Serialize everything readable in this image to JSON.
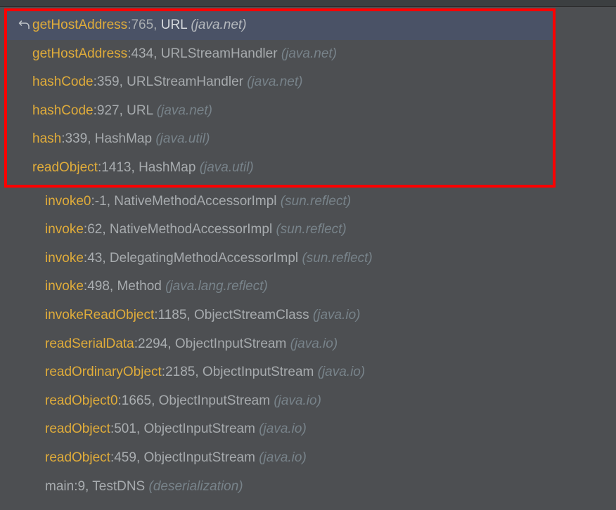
{
  "frames": [
    {
      "method": "getHostAddress",
      "line": "765",
      "class": "URL",
      "package": "(java.net)",
      "selected": true,
      "hasIcon": true,
      "inBox": true
    },
    {
      "method": "getHostAddress",
      "line": "434",
      "class": "URLStreamHandler",
      "package": "(java.net)",
      "selected": false,
      "hasIcon": false,
      "inBox": true
    },
    {
      "method": "hashCode",
      "line": "359",
      "class": "URLStreamHandler",
      "package": "(java.net)",
      "selected": false,
      "hasIcon": false,
      "inBox": true
    },
    {
      "method": "hashCode",
      "line": "927",
      "class": "URL",
      "package": "(java.net)",
      "selected": false,
      "hasIcon": false,
      "inBox": true
    },
    {
      "method": "hash",
      "line": "339",
      "class": "HashMap",
      "package": "(java.util)",
      "selected": false,
      "hasIcon": false,
      "inBox": true
    },
    {
      "method": "readObject",
      "line": "1413",
      "class": "HashMap",
      "package": "(java.util)",
      "selected": false,
      "hasIcon": false,
      "inBox": true
    },
    {
      "method": "invoke0",
      "line": "-1",
      "class": "NativeMethodAccessorImpl",
      "package": "(sun.reflect)",
      "selected": false,
      "hasIcon": false,
      "inBox": false
    },
    {
      "method": "invoke",
      "line": "62",
      "class": "NativeMethodAccessorImpl",
      "package": "(sun.reflect)",
      "selected": false,
      "hasIcon": false,
      "inBox": false
    },
    {
      "method": "invoke",
      "line": "43",
      "class": "DelegatingMethodAccessorImpl",
      "package": "(sun.reflect)",
      "selected": false,
      "hasIcon": false,
      "inBox": false
    },
    {
      "method": "invoke",
      "line": "498",
      "class": "Method",
      "package": "(java.lang.reflect)",
      "selected": false,
      "hasIcon": false,
      "inBox": false
    },
    {
      "method": "invokeReadObject",
      "line": "1185",
      "class": "ObjectStreamClass",
      "package": "(java.io)",
      "selected": false,
      "hasIcon": false,
      "inBox": false
    },
    {
      "method": "readSerialData",
      "line": "2294",
      "class": "ObjectInputStream",
      "package": "(java.io)",
      "selected": false,
      "hasIcon": false,
      "inBox": false
    },
    {
      "method": "readOrdinaryObject",
      "line": "2185",
      "class": "ObjectInputStream",
      "package": "(java.io)",
      "selected": false,
      "hasIcon": false,
      "inBox": false
    },
    {
      "method": "readObject0",
      "line": "1665",
      "class": "ObjectInputStream",
      "package": "(java.io)",
      "selected": false,
      "hasIcon": false,
      "inBox": false
    },
    {
      "method": "readObject",
      "line": "501",
      "class": "ObjectInputStream",
      "package": "(java.io)",
      "selected": false,
      "hasIcon": false,
      "inBox": false
    },
    {
      "method": "readObject",
      "line": "459",
      "class": "ObjectInputStream",
      "package": "(java.io)",
      "selected": false,
      "hasIcon": false,
      "inBox": false
    },
    {
      "method": "main",
      "line": "9",
      "class": "TestDNS",
      "package": "(deserialization)",
      "selected": false,
      "hasIcon": false,
      "inBox": false,
      "isMain": true
    }
  ],
  "icons": {
    "undo": "undo-icon"
  }
}
